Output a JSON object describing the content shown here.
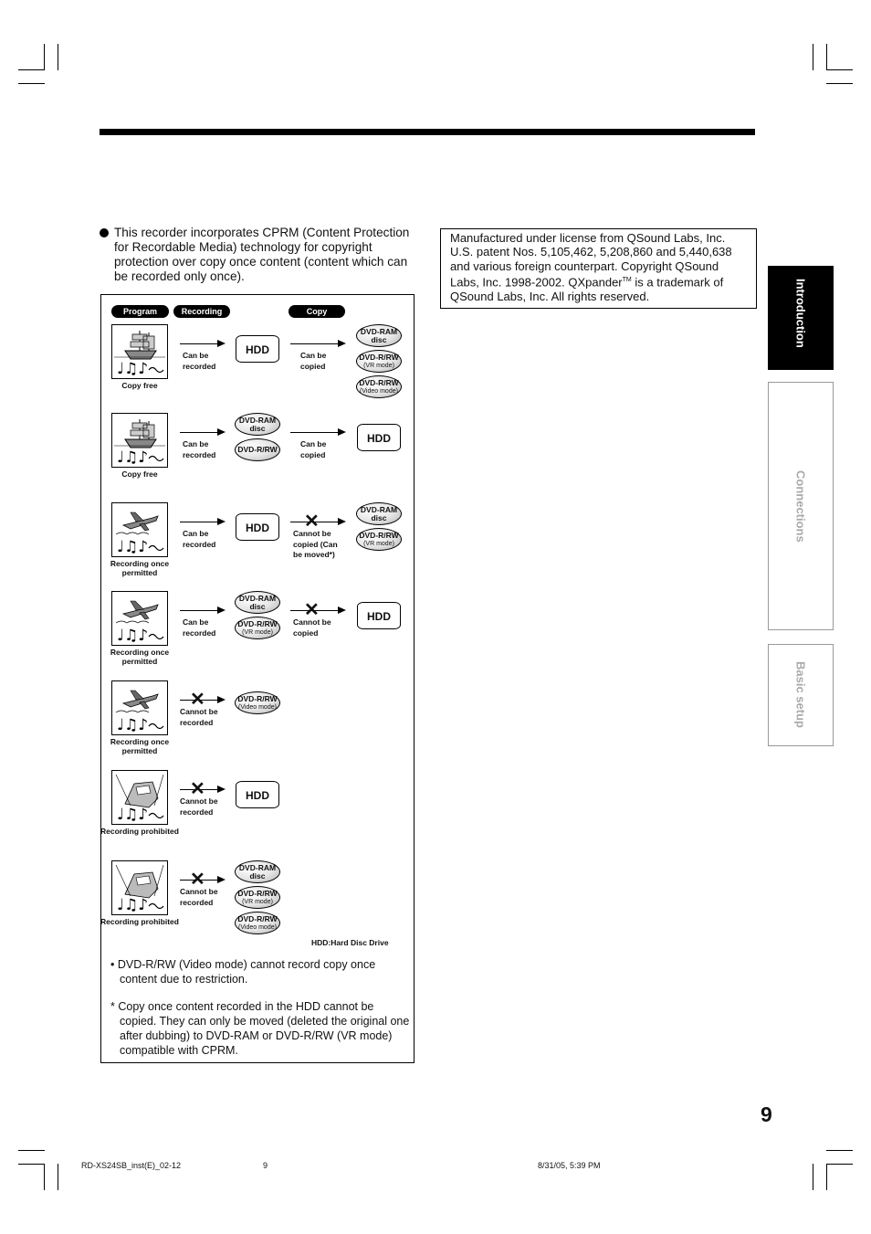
{
  "intro_text": "This recorder incorporates CPRM (Content Protection for Recordable Media) technology for copyright protection over copy once content (content which can be recorded only once).",
  "notice": {
    "text_before_tm": "Manufactured under license from QSound Labs, Inc. U.S. patent Nos. 5,105,462, 5,208,860 and 5,440,638 and various foreign counterpart. Copyright QSound Labs, Inc. 1998-2002. QXpander",
    "tm": "TM",
    "text_after_tm": " is a trademark of QSound Labs, Inc. All rights reserved."
  },
  "diagram": {
    "headers": {
      "program": "Program",
      "recording": "Recording",
      "copy": "Copy"
    },
    "rows": [
      {
        "icon": "ship-icon",
        "label": "Copy free",
        "rec_ok": true,
        "rec_text": "Can be recorded",
        "rec_targets": [
          "HDD"
        ],
        "copy": "ok",
        "copy_text": "Can be copied",
        "copy_targets": [
          "DVD-RAM|disc",
          "DVD-R/RW|(VR mode)",
          "DVD-R/RW|(Video mode)"
        ]
      },
      {
        "icon": "ship-icon",
        "label": "Copy free",
        "rec_ok": true,
        "rec_text": "Can be recorded",
        "rec_targets": [
          "DVD-RAM|disc",
          "DVD-R/RW|"
        ],
        "copy": "ok",
        "copy_text": "Can be copied",
        "copy_targets": [
          "HDD"
        ]
      },
      {
        "icon": "airplane-icon",
        "label": "Recording once permitted",
        "rec_ok": true,
        "rec_text": "Can be recorded",
        "rec_targets": [
          "HDD"
        ],
        "copy": "no",
        "copy_text": "Cannot be copied (Can be moved*)",
        "copy_targets": [
          "DVD-RAM|disc",
          "DVD-R/RW|(VR mode)"
        ]
      },
      {
        "icon": "airplane-icon",
        "label": "Recording once permitted",
        "rec_ok": true,
        "rec_text": "Can be recorded",
        "rec_targets": [
          "DVD-RAM|disc",
          "DVD-R/RW|(VR mode)"
        ],
        "copy": "no",
        "copy_text": "Cannot be copied",
        "copy_targets": [
          "HDD"
        ]
      },
      {
        "icon": "airplane-icon",
        "label": "Recording once permitted",
        "rec_ok": false,
        "rec_text": "Cannot be recorded",
        "rec_targets": [
          "DVD-R/RW|(Video mode)"
        ],
        "copy": "none",
        "copy_text": "",
        "copy_targets": []
      },
      {
        "icon": "car-icon",
        "label": "Recording prohibited",
        "rec_ok": false,
        "rec_text": "Cannot be recorded",
        "rec_targets": [
          "HDD"
        ],
        "copy": "none",
        "copy_text": "",
        "copy_targets": []
      },
      {
        "icon": "car-icon",
        "label": "Recording prohibited",
        "rec_ok": false,
        "rec_text": "Cannot be recorded",
        "rec_targets": [
          "DVD-RAM|disc",
          "DVD-R/RW|(VR mode)",
          "DVD-R/RW|(Video mode)"
        ],
        "copy": "none",
        "copy_text": "",
        "copy_targets": []
      }
    ],
    "legend": "HDD:Hard Disc Drive",
    "note1": "• DVD-R/RW (Video mode) cannot record copy once content due to restriction.",
    "note2": "* Copy once content recorded in the HDD cannot be copied. They can only be moved (deleted the original one after dubbing) to DVD-RAM or DVD-R/RW (VR mode) compatible with CPRM."
  },
  "side_tabs": [
    {
      "label": "Introduction",
      "active": true
    },
    {
      "label": "Connections",
      "active": false
    },
    {
      "label": "Basic setup",
      "active": false
    }
  ],
  "page_number": "9",
  "footer": {
    "file": "RD-XS24SB_inst(E)_02-12",
    "page": "9",
    "date": "8/31/05, 5:39 PM"
  }
}
